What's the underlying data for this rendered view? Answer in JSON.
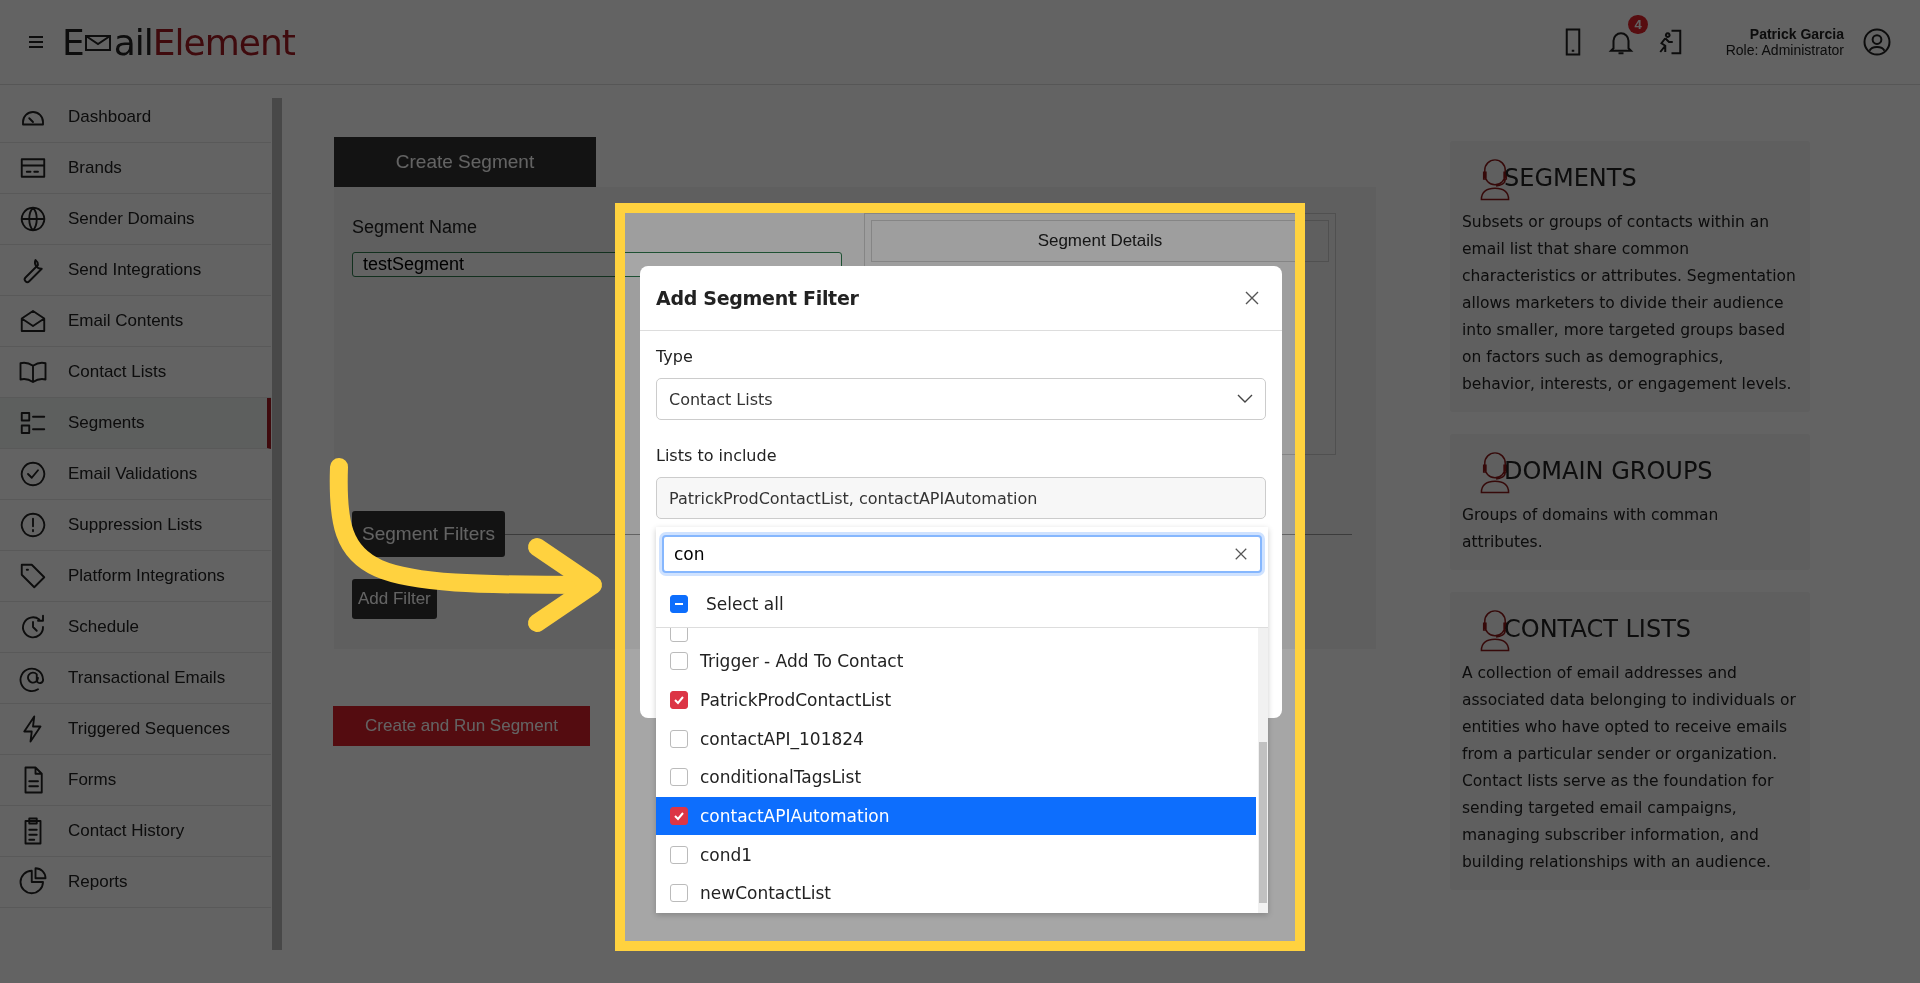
{
  "header": {
    "logo": {
      "first": "E",
      "middle": "ail",
      "last": "Element"
    },
    "notification_count": "4",
    "user": {
      "name": "Patrick Garcia",
      "role": "Role: Administrator"
    }
  },
  "sidebar": {
    "items": [
      {
        "label": "Dashboard",
        "selected": false
      },
      {
        "label": "Brands",
        "selected": false
      },
      {
        "label": "Sender Domains",
        "selected": false
      },
      {
        "label": "Send Integrations",
        "selected": false
      },
      {
        "label": "Email Contents",
        "selected": false
      },
      {
        "label": "Contact Lists",
        "selected": false
      },
      {
        "label": "Segments",
        "selected": true
      },
      {
        "label": "Email Validations",
        "selected": false
      },
      {
        "label": "Suppression Lists",
        "selected": false
      },
      {
        "label": "Platform Integrations",
        "selected": false
      },
      {
        "label": "Schedule",
        "selected": false
      },
      {
        "label": "Transactional Emails",
        "selected": false
      },
      {
        "label": "Triggered Sequences",
        "selected": false
      },
      {
        "label": "Forms",
        "selected": false
      },
      {
        "label": "Contact History",
        "selected": false
      },
      {
        "label": "Reports",
        "selected": false
      }
    ]
  },
  "form": {
    "tab": "Create Segment",
    "name_label": "Segment Name",
    "name_value": "testSegment",
    "details_title": "Segment Details",
    "filters_button": "Segment Filters",
    "add_filter_button": "Add Filter",
    "submit_button": "Create and Run Segment"
  },
  "info_cards": [
    {
      "title": "SEGMENTS",
      "text": "Subsets or groups of contacts within an email list that share common characteristics or attributes. Segmentation allows marketers to divide their audience into smaller, more targeted groups based on factors such as demographics, behavior, interests, or engagement levels."
    },
    {
      "title": "DOMAIN GROUPS",
      "text": "Groups of domains with comman attributes."
    },
    {
      "title": "CONTACT LISTS",
      "text": "A collection of email addresses and associated data belonging to individuals or entities who have opted to receive emails from a particular sender or organization. Contact lists serve as the foundation for sending targeted email campaigns, managing subscriber information, and building relationships with an audience."
    }
  ],
  "modal": {
    "title": "Add Segment Filter",
    "type_label": "Type",
    "type_value": "Contact Lists",
    "lists_label": "Lists to include",
    "lists_value": "PatrickProdContactList, contactAPIAutomation",
    "dropdown": {
      "search_value": "con",
      "select_all": {
        "label": "Select all",
        "indeterminate": true
      },
      "cut_off_option": {
        "checked": false
      },
      "options": [
        {
          "label": "Trigger - Add To Contact",
          "checked": false,
          "selected": false
        },
        {
          "label": "PatrickProdContactList",
          "checked": true,
          "selected": false
        },
        {
          "label": "contactAPI_101824",
          "checked": false,
          "selected": false
        },
        {
          "label": "conditionalTagsList",
          "checked": false,
          "selected": false
        },
        {
          "label": "contactAPIAutomation",
          "checked": true,
          "selected": true
        },
        {
          "label": "cond1",
          "checked": false,
          "selected": false
        },
        {
          "label": "newContactList",
          "checked": false,
          "selected": false
        }
      ]
    }
  }
}
